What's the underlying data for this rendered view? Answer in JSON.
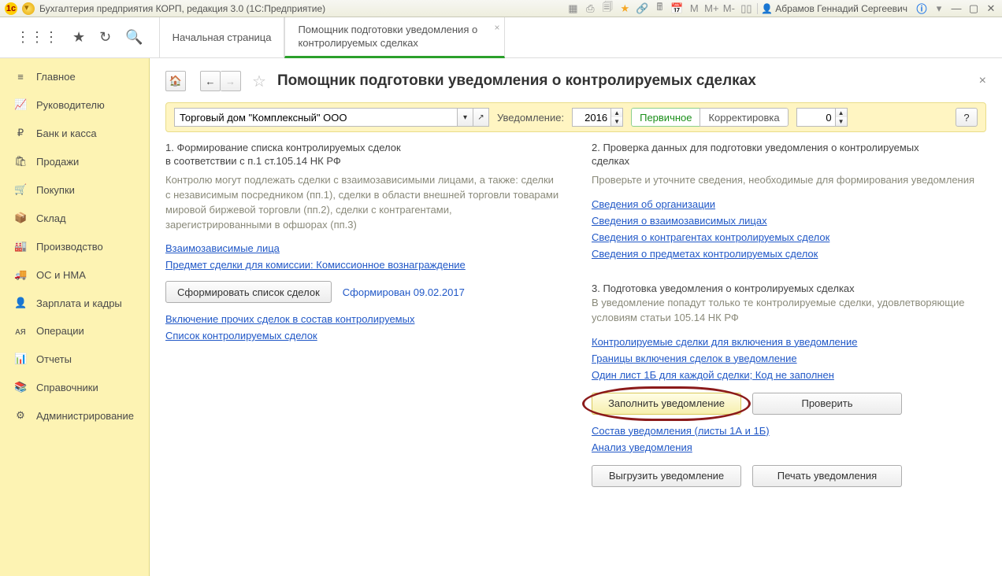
{
  "titlebar": {
    "app_title": "Бухгалтерия предприятия КОРП, редакция 3.0  (1С:Предприятие)",
    "memory": {
      "m": "M",
      "mplus": "M+",
      "mminus": "M-"
    },
    "user": "Абрамов Геннадий Сергеевич"
  },
  "topbar": {
    "tab_home": "Начальная страница",
    "tab_active": "Помощник подготовки уведомления о контролируемых сделках"
  },
  "sidebar": {
    "items": [
      {
        "icon": "≡",
        "label": "Главное"
      },
      {
        "icon": "📈",
        "label": "Руководителю"
      },
      {
        "icon": "₽",
        "label": "Банк и касса"
      },
      {
        "icon": "🛍",
        "label": "Продажи"
      },
      {
        "icon": "🛒",
        "label": "Покупки"
      },
      {
        "icon": "📦",
        "label": "Склад"
      },
      {
        "icon": "🏭",
        "label": "Производство"
      },
      {
        "icon": "🚚",
        "label": "ОС и НМА"
      },
      {
        "icon": "👤",
        "label": "Зарплата и кадры"
      },
      {
        "icon": "ᴀя",
        "label": "Операции"
      },
      {
        "icon": "📊",
        "label": "Отчеты"
      },
      {
        "icon": "📚",
        "label": "Справочники"
      },
      {
        "icon": "⚙",
        "label": "Администрирование"
      }
    ]
  },
  "page": {
    "title": "Помощник подготовки уведомления о контролируемых сделках",
    "org": "Торговый дом \"Комплексный\" ООО",
    "notif_label": "Уведомление:",
    "year": "2016",
    "seg_primary": "Первичное",
    "seg_corr": "Корректировка",
    "corr_num": "0",
    "help": "?"
  },
  "left": {
    "step1_line1": "1. Формирование списка контролируемых сделок",
    "step1_line2": "в соответствии с п.1 ст.105.14 НК РФ",
    "step1_text": "Контролю могут подлежать сделки с взаимозависимыми лицами, а также: сделки с независимым посредником (пп.1), сделки в области внешней торговли товарами мировой биржевой торговли (пп.2), сделки с контрагентами, зарегистрированными в офшорах (пп.3)",
    "link_vz": "Взаимозависимые лица",
    "link_subj": "Предмет сделки для комиссии: Комиссионное вознаграждение",
    "btn_form": "Сформировать список сделок",
    "formed": "Сформирован 09.02.2017",
    "link_incl": "Включение прочих сделок в состав контролируемых",
    "link_list": "Список контролируемых сделок"
  },
  "right": {
    "step2_line1": "2. Проверка данных для подготовки уведомления о контролируемых",
    "step2_line2": "сделках",
    "step2_text": "Проверьте и уточните сведения, необходимые для формирования уведомления",
    "link_org": "Сведения об организации",
    "link_vzl": "Сведения о взаимозависимых лицах",
    "link_contr": "Сведения о контрагентах контролируемых сделок",
    "link_subj2": "Сведения о предметах контролируемых сделок",
    "step3_title": "3. Подготовка уведомления о контролируемых сделках",
    "step3_text": "В уведомление попадут только те контролируемые сделки, удовлетворяющие условиям статьи 105.14 НК РФ",
    "link_ks": "Контролируемые сделки для включения в уведомление",
    "link_bounds": "Границы включения сделок в уведомление",
    "link_sheet": "Один лист 1Б для каждой сделки; Код не заполнен",
    "btn_fill": "Заполнить уведомление",
    "btn_check": "Проверить",
    "link_comp": "Состав уведомления (листы 1А и 1Б)",
    "link_anal": "Анализ уведомления",
    "btn_export": "Выгрузить уведомление",
    "btn_print": "Печать уведомления"
  }
}
